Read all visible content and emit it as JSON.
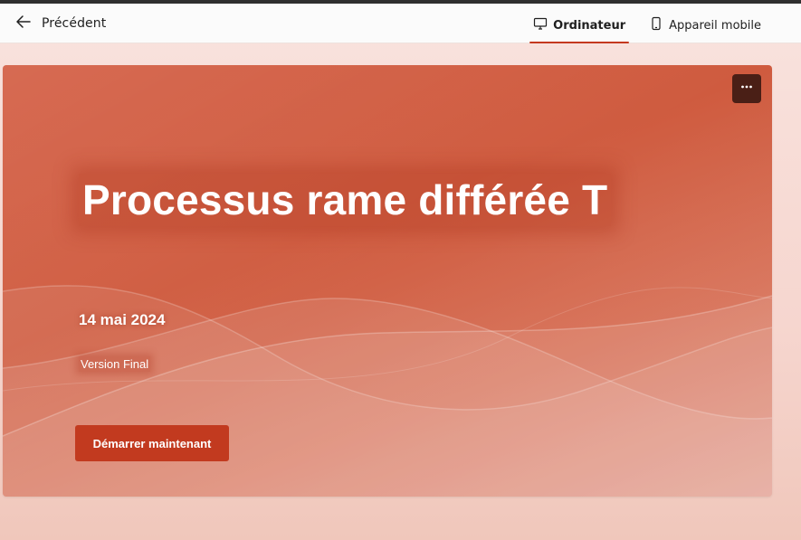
{
  "topbar": {
    "back_label": "Précédent",
    "back_icon": "arrow-left-icon",
    "view_tabs": [
      {
        "label": "Ordinateur",
        "icon": "desktop-icon",
        "active": true
      },
      {
        "label": "Appareil mobile",
        "icon": "mobile-icon",
        "active": false
      }
    ]
  },
  "hero": {
    "title": "Processus rame différée T",
    "date": "14 mai 2024",
    "version": "Version Final",
    "start_button_label": "Démarrer maintenant",
    "menu_icon": "more-horizontal-icon"
  },
  "colors": {
    "accent": "#c4391f",
    "hero_background": "#cf5b3f",
    "button_background": "#c23a1f",
    "menu_button_background": "#4a1f16",
    "page_background": "#f6d6cf"
  }
}
